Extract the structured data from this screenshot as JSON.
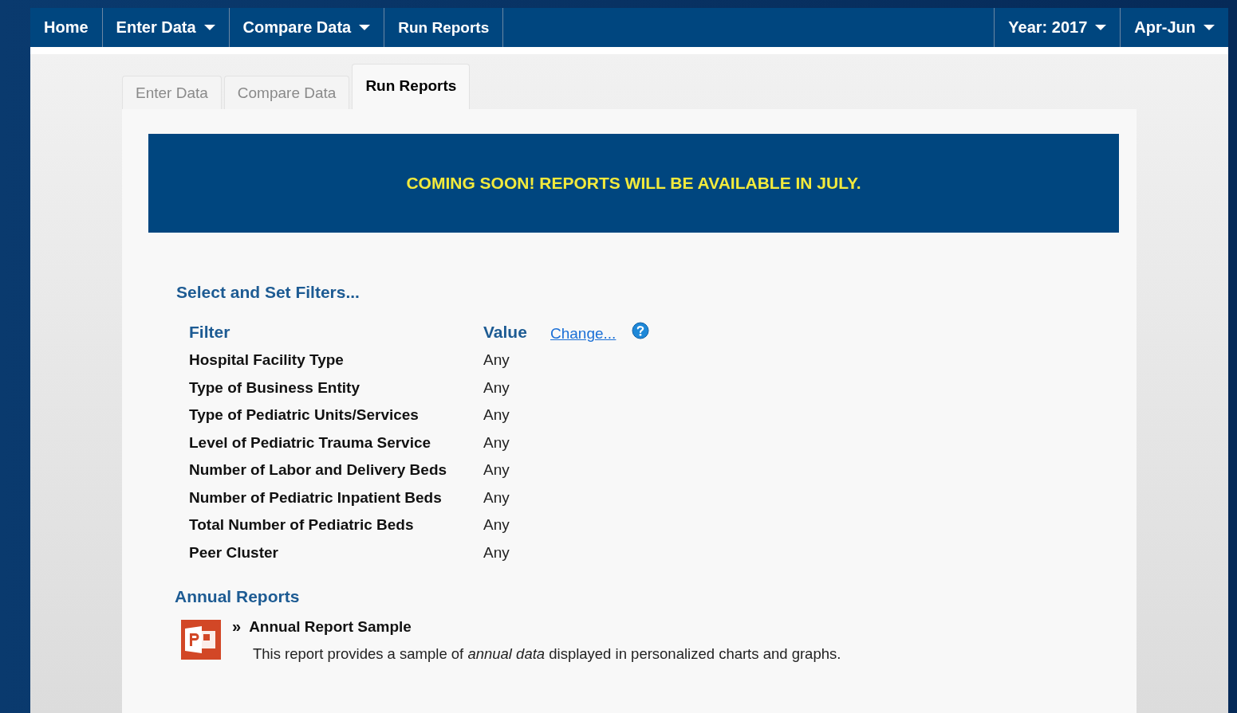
{
  "nav": {
    "items": [
      {
        "label": "Home",
        "dropdown": false
      },
      {
        "label": "Enter Data",
        "dropdown": true
      },
      {
        "label": "Compare Data",
        "dropdown": true
      },
      {
        "label": "Run Reports",
        "dropdown": false
      }
    ],
    "right_items": [
      {
        "label": "Year: 2017",
        "dropdown": true
      },
      {
        "label": "Apr-Jun",
        "dropdown": true
      }
    ]
  },
  "tabs": [
    {
      "label": "Enter Data",
      "selected": false
    },
    {
      "label": "Compare Data",
      "selected": false
    },
    {
      "label": "Run Reports",
      "selected": true
    }
  ],
  "banner": "COMING SOON! REPORTS WILL BE AVAILABLE IN JULY.",
  "filters": {
    "heading": "Select and Set Filters...",
    "filter_header": "Filter",
    "value_header": "Value",
    "change_link": "Change...",
    "rows": [
      {
        "filter": "Hospital Facility Type",
        "value": "Any"
      },
      {
        "filter": "Type of Business Entity",
        "value": "Any"
      },
      {
        "filter": "Type of Pediatric Units/Services",
        "value": "Any"
      },
      {
        "filter": "Level of Pediatric Trauma Service",
        "value": "Any"
      },
      {
        "filter": "Number of Labor and Delivery Beds",
        "value": "Any"
      },
      {
        "filter": "Number of Pediatric Inpatient Beds",
        "value": "Any"
      },
      {
        "filter": "Total Number of Pediatric Beds",
        "value": "Any"
      },
      {
        "filter": "Peer Cluster",
        "value": "Any"
      }
    ]
  },
  "reports": {
    "heading": "Annual Reports",
    "items": [
      {
        "marker": "»",
        "title": "Annual Report Sample",
        "description": "This report provides a sample of *annual data* displayed in personalized charts and graphs."
      }
    ]
  }
}
